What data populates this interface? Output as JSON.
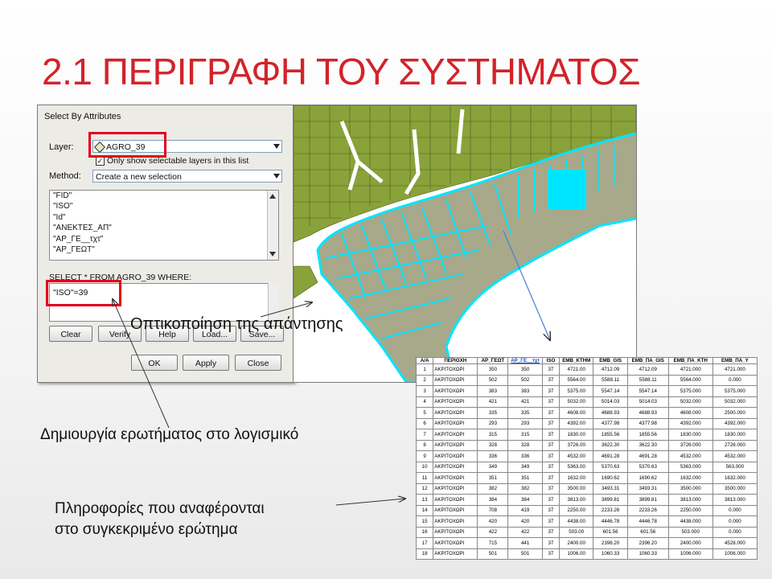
{
  "slide": {
    "title": "2.1 ΠΕΡΙΓΡΑΦΗ ΤΟΥ ΣΥΣΤΗΜΑΤΟΣ",
    "caption_visualization": "Οπτικοποίηση της απάντησης",
    "caption_query": "Δημιουργία ερωτήματος στο λογισμικό",
    "caption_info_line1": "Πληροφορίες που αναφέρονται",
    "caption_info_line2": "στο συγκεκριμένο ερώτημα",
    "title_color": "#d2232a",
    "highlight_color": "#e3001b"
  },
  "dialog": {
    "title": "Select By Attributes",
    "layer_label": "Layer:",
    "layer_value": "AGRO_39",
    "selectable_checkbox_label": "Only show selectable layers in this list",
    "selectable_checked": true,
    "method_label": "Method:",
    "method_value": "Create a new selection",
    "fields": [
      "\"FID\"",
      "\"ISO\"",
      "\"Id\"",
      "\"ΑΝΕΚΤΕΣ_ΑΠ\"",
      "\"ΑΡ_ΓΕ__τχτ\"",
      "\"ΑΡ_ΓΕΩΤ\""
    ],
    "sql_prefix": "SELECT * FROM AGRO_39 WHERE:",
    "sql_expression": "\"ISO\"=39",
    "buttons": {
      "clear": "Clear",
      "verify": "Verify",
      "help": "Help",
      "load": "Load...",
      "save": "Save...",
      "ok": "OK",
      "apply": "Apply",
      "close": "Close"
    }
  },
  "map": {
    "parcel_color": "#8aa23a",
    "selected_color": "#00e5ff",
    "selected_fill": "#a8a88a",
    "background": "#ffffff"
  },
  "table": {
    "headers": [
      "Α/Α",
      "ΠΕΡΙΟΧΗ",
      "ΑΡ_ΓΕΩΤ",
      "ΑΡ_ΓΕ__τχτ",
      "ISO",
      "ΕΜΒ_ΚΤΗΜ",
      "ΕΜΒ_GIS",
      "ΕΜΒ_ΠΑ_GIS",
      "ΕΜΒ_ΠΑ_ΚΤΗ",
      "ΕΜΒ_ΠΑ_Υ"
    ],
    "rows": [
      [
        "1",
        "ΑΚΡΙΤΟΧΩΡΙ",
        "350",
        "350",
        "37",
        "4721.00",
        "4712.09",
        "4712.09",
        "4721.000",
        "4721.000"
      ],
      [
        "2",
        "ΑΚΡΙΤΟΧΩΡΙ",
        "502",
        "502",
        "37",
        "5564.00",
        "5588.11",
        "5588.11",
        "5564.000",
        "0.000"
      ],
      [
        "3",
        "ΑΚΡΙΤΟΧΩΡΙ",
        "383",
        "383",
        "37",
        "5375.00",
        "5547.14",
        "5547.14",
        "5375.000",
        "5375.000"
      ],
      [
        "4",
        "ΑΚΡΙΤΟΧΩΡΙ",
        "421",
        "421",
        "37",
        "5032.00",
        "5014.03",
        "5014.03",
        "5032.000",
        "5032.000"
      ],
      [
        "5",
        "ΑΚΡΙΤΟΧΩΡΙ",
        "335",
        "335",
        "37",
        "4608.00",
        "4688.93",
        "4688.93",
        "4608.000",
        "2500.000"
      ],
      [
        "6",
        "ΑΚΡΙΤΟΧΩΡΙ",
        "293",
        "293",
        "37",
        "4392.00",
        "4377.98",
        "4377.98",
        "4392.000",
        "4392.000"
      ],
      [
        "7",
        "ΑΚΡΙΤΟΧΩΡΙ",
        "315",
        "315",
        "37",
        "1830.00",
        "1855.56",
        "1855.56",
        "1830.000",
        "1830.000"
      ],
      [
        "8",
        "ΑΚΡΙΤΟΧΩΡΙ",
        "328",
        "328",
        "37",
        "3726.00",
        "3622.30",
        "3622.30",
        "3726.000",
        "2726.000"
      ],
      [
        "9",
        "ΑΚΡΙΤΟΧΩΡΙ",
        "336",
        "336",
        "37",
        "4532.00",
        "4691.28",
        "4691.28",
        "4532.000",
        "4532.000"
      ],
      [
        "10",
        "ΑΚΡΙΤΟΧΩΡΙ",
        "349",
        "349",
        "37",
        "5363.00",
        "5370.63",
        "5370.63",
        "5363.000",
        "563.000"
      ],
      [
        "11",
        "ΑΚΡΙΤΟΧΩΡΙ",
        "351",
        "351",
        "37",
        "1632.00",
        "1690.62",
        "1690.62",
        "1632.000",
        "1632.000"
      ],
      [
        "12",
        "ΑΚΡΙΤΟΧΩΡΙ",
        "382",
        "382",
        "37",
        "3500.00",
        "3493.31",
        "3493.31",
        "3500.000",
        "3500.000"
      ],
      [
        "13",
        "ΑΚΡΙΤΟΧΩΡΙ",
        "384",
        "384",
        "37",
        "3813.00",
        "3899.81",
        "3899.81",
        "3813.000",
        "3813.000"
      ],
      [
        "14",
        "ΑΚΡΙΤΟΧΩΡΙ",
        "708",
        "419",
        "37",
        "2250.00",
        "2233.26",
        "2233.26",
        "2250.000",
        "0.000"
      ],
      [
        "15",
        "ΑΚΡΙΤΟΧΩΡΙ",
        "420",
        "420",
        "37",
        "4438.00",
        "4446.78",
        "4446.78",
        "4438.000",
        "0.000"
      ],
      [
        "16",
        "ΑΚΡΙΤΟΧΩΡΙ",
        "422",
        "422",
        "37",
        "503.00",
        "601.56",
        "601.56",
        "503.000",
        "0.000"
      ],
      [
        "17",
        "ΑΚΡΙΤΟΧΩΡΙ",
        "715",
        "441",
        "37",
        "2400.00",
        "2396.20",
        "2396.20",
        "2400.000",
        "4528.000"
      ],
      [
        "18",
        "ΑΚΡΙΤΟΧΩΡΙ",
        "501",
        "501",
        "37",
        "1006.00",
        "1060.33",
        "1060.33",
        "1006.000",
        "1006.000"
      ]
    ]
  }
}
